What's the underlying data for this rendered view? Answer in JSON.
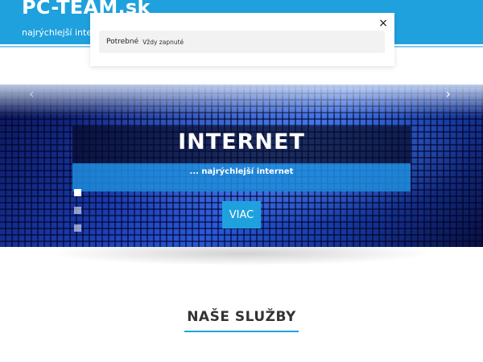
{
  "site": {
    "title": "PC-TEAM.sk",
    "tagline": "najrýchlejší internet"
  },
  "cookie_modal": {
    "close_symbol": "×",
    "category_label": "Potrebné",
    "category_state": "Vždy zapnuté"
  },
  "hero": {
    "title": "INTERNET",
    "subtitle": "... najrýchlejší internet",
    "button_label": "VIAC",
    "arrow_prev": "‹",
    "arrow_next": "›",
    "slides": 3,
    "active_slide": 1
  },
  "services": {
    "title": "NAŠE SLUŽBY"
  },
  "colors": {
    "accent": "#1fa1dd"
  }
}
